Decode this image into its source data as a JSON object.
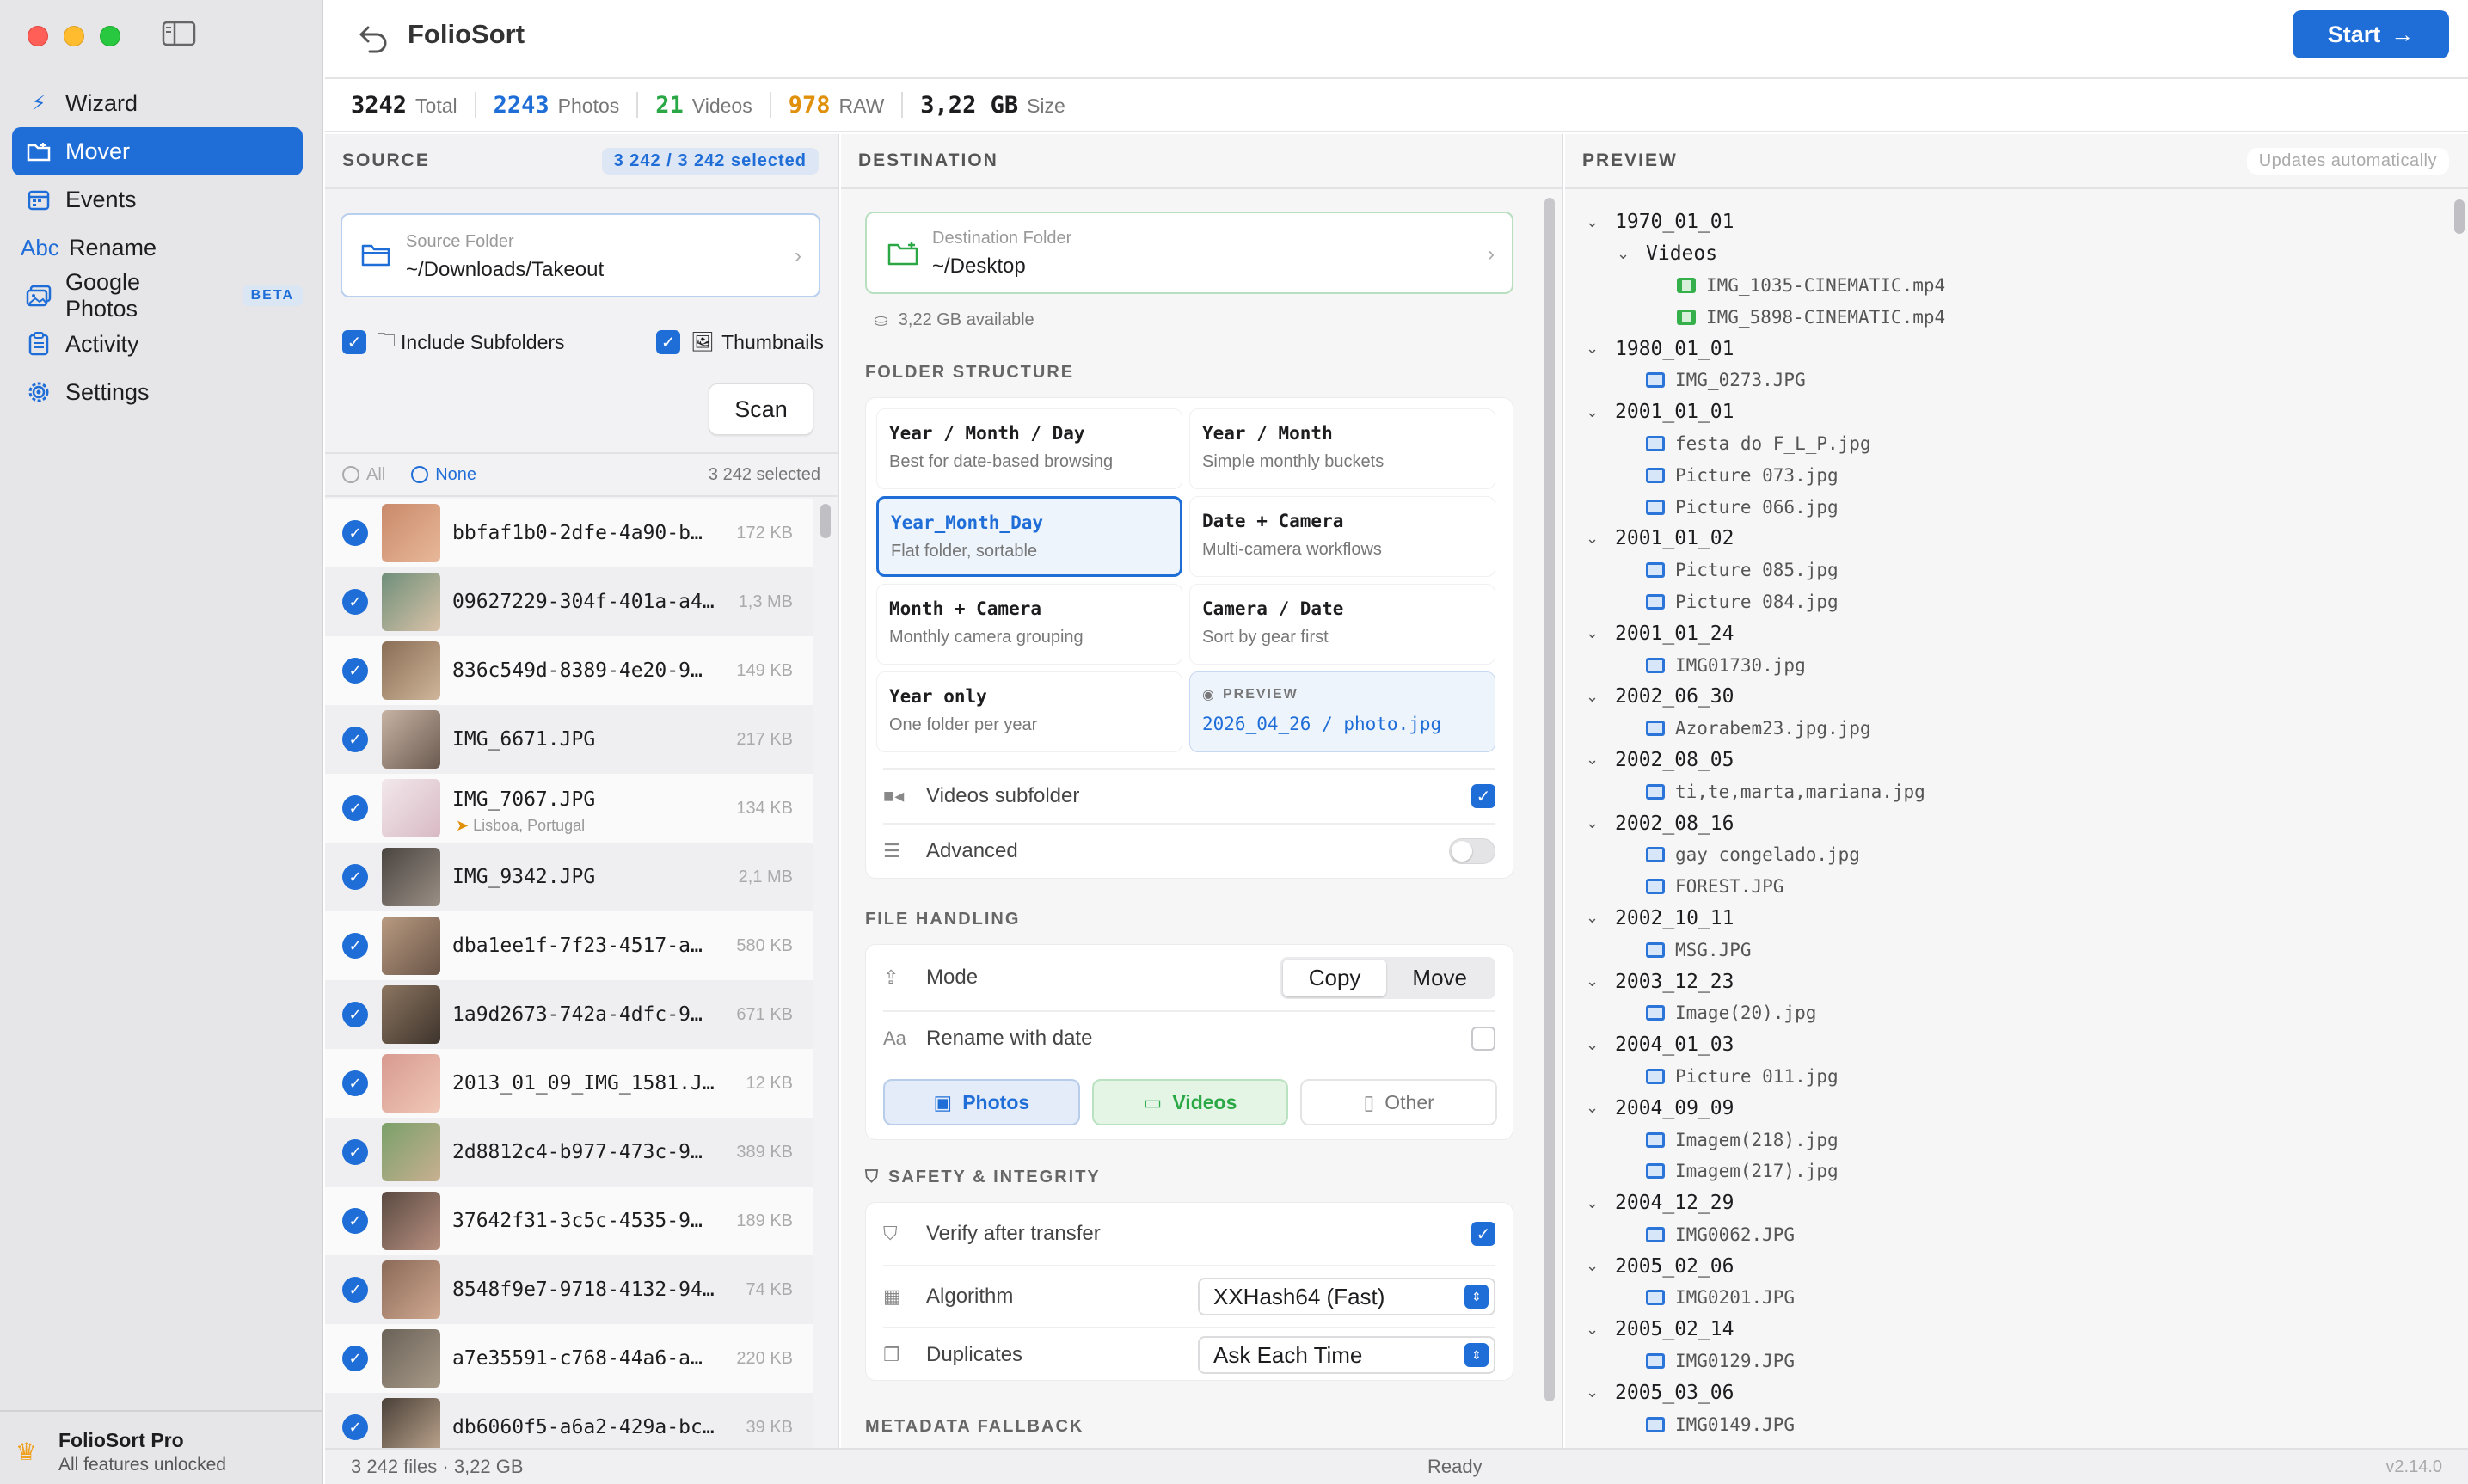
{
  "colors": {
    "accent": "#1f6ed8",
    "photos": "#1f6ed8",
    "videos": "#2aa845",
    "raw": "#e0900a",
    "total": "#1d1d1f"
  },
  "sidebar": {
    "items": [
      {
        "label": "Wizard",
        "icon": "wand-icon"
      },
      {
        "label": "Mover",
        "icon": "folder-move-icon",
        "active": true
      },
      {
        "label": "Events",
        "icon": "calendar-icon"
      },
      {
        "label": "Rename",
        "icon": "abc-icon",
        "icon_text": "Abc"
      },
      {
        "label": "Google Photos",
        "icon": "photos-icon",
        "badge": "BETA"
      },
      {
        "label": "Activity",
        "icon": "clipboard-icon"
      },
      {
        "label": "Settings",
        "icon": "gear-icon"
      }
    ],
    "pro_title": "FolioSort Pro",
    "pro_sub": "All features unlocked"
  },
  "header": {
    "title": "FolioSort",
    "start_label": "Start"
  },
  "stats": [
    {
      "num": "3242",
      "label": "Total"
    },
    {
      "num": "2243",
      "label": "Photos"
    },
    {
      "num": "21",
      "label": "Videos"
    },
    {
      "num": "978",
      "label": "RAW"
    },
    {
      "num": "3,22 GB",
      "label": "Size"
    }
  ],
  "source": {
    "title": "SOURCE",
    "selected_pill": "3 242 / 3 242 selected",
    "folder_label": "Source Folder",
    "folder_value": "~/Downloads/Takeout",
    "include_subfolders": "Include Subfolders",
    "thumbnails": "Thumbnails",
    "scan_label": "Scan",
    "all_label": "All",
    "none_label": "None",
    "count_label": "3 242 selected",
    "files": [
      {
        "name": "bbfaf1b0-2dfe-4a90-b…",
        "size": "172 KB",
        "c1": "#c98a6a",
        "c2": "#e8b89a"
      },
      {
        "name": "09627229-304f-401a-a4…",
        "size": "1,3 MB",
        "c1": "#6f8f7a",
        "c2": "#d9c2a8"
      },
      {
        "name": "836c549d-8389-4e20-9…",
        "size": "149 KB",
        "c1": "#8a6d55",
        "c2": "#cfb69a"
      },
      {
        "name": "IMG_6671.JPG",
        "size": "217 KB",
        "c1": "#c7b3a4",
        "c2": "#6b5a50"
      },
      {
        "name": "IMG_7067.JPG",
        "size": "134 KB",
        "loc": "Lisboa, Portugal",
        "c1": "#f2e8ec",
        "c2": "#d8b9c4"
      },
      {
        "name": "IMG_9342.JPG",
        "size": "2,1 MB",
        "c1": "#4a4440",
        "c2": "#9a8f86"
      },
      {
        "name": "dba1ee1f-7f23-4517-a…",
        "size": "580 KB",
        "c1": "#b89a80",
        "c2": "#6a5548"
      },
      {
        "name": "1a9d2673-742a-4dfc-9…",
        "size": "671 KB",
        "c1": "#8c7560",
        "c2": "#3e342c"
      },
      {
        "name": "2013_01_09_IMG_1581.J…",
        "size": "12 KB",
        "c1": "#d89a90",
        "c2": "#f0c8b8"
      },
      {
        "name": "2d8812c4-b977-473c-9…",
        "size": "389 KB",
        "c1": "#7aa06a",
        "c2": "#c8b090"
      },
      {
        "name": "37642f31-3c5c-4535-9…",
        "size": "189 KB",
        "c1": "#5a4a42",
        "c2": "#b89080"
      },
      {
        "name": "8548f9e7-9718-4132-94…",
        "size": "74 KB",
        "c1": "#8a6a58",
        "c2": "#d0a890"
      },
      {
        "name": "a7e35591-c768-44a6-a…",
        "size": "220 KB",
        "c1": "#6a6258",
        "c2": "#a89a88"
      },
      {
        "name": "db6060f5-a6a2-429a-bc…",
        "size": "39 KB",
        "c1": "#4a4038",
        "c2": "#c0a890"
      }
    ]
  },
  "destination": {
    "title": "DESTINATION",
    "folder_label": "Destination Folder",
    "folder_value": "~/Desktop",
    "available": "3,22 GB available",
    "folder_structure_title": "FOLDER STRUCTURE",
    "options": [
      {
        "t": "Year / Month / Day",
        "s": "Best for date-based browsing"
      },
      {
        "t": "Year / Month",
        "s": "Simple monthly buckets"
      },
      {
        "t": "Year_Month_Day",
        "s": "Flat folder, sortable",
        "selected": true
      },
      {
        "t": "Date + Camera",
        "s": "Multi-camera workflows"
      },
      {
        "t": "Month + Camera",
        "s": "Monthly camera grouping"
      },
      {
        "t": "Camera / Date",
        "s": "Sort by gear first"
      },
      {
        "t": "Year only",
        "s": "One folder per year"
      }
    ],
    "preview_label": "PREVIEW",
    "preview_value": "2026_04_26 / photo.jpg",
    "videos_subfolder": "Videos subfolder",
    "advanced": "Advanced",
    "file_handling_title": "FILE HANDLING",
    "mode_label": "Mode",
    "mode_copy": "Copy",
    "mode_move": "Move",
    "rename_label": "Rename with date",
    "rename_icon_text": "Aa",
    "type_photos": "Photos",
    "type_videos": "Videos",
    "type_other": "Other",
    "safety_title": "SAFETY & INTEGRITY",
    "verify_label": "Verify after transfer",
    "algorithm_label": "Algorithm",
    "algorithm_value": "XXHash64 (Fast)",
    "duplicates_label": "Duplicates",
    "duplicates_value": "Ask Each Time",
    "metadata_title": "METADATA FALLBACK"
  },
  "preview": {
    "title": "PREVIEW",
    "auto_pill": "Updates automatically",
    "tree": [
      {
        "depth": 0,
        "kind": "folder",
        "label": "1970_01_01"
      },
      {
        "depth": 1,
        "kind": "folder",
        "label": "Videos"
      },
      {
        "depth": 2,
        "kind": "video",
        "label": "IMG_1035-CINEMATIC.mp4"
      },
      {
        "depth": 2,
        "kind": "video",
        "label": "IMG_5898-CINEMATIC.mp4"
      },
      {
        "depth": 0,
        "kind": "folder",
        "label": "1980_01_01"
      },
      {
        "depth": 1,
        "kind": "image",
        "label": "IMG_0273.JPG"
      },
      {
        "depth": 0,
        "kind": "folder",
        "label": "2001_01_01"
      },
      {
        "depth": 1,
        "kind": "image",
        "label": "festa do F_L_P.jpg"
      },
      {
        "depth": 1,
        "kind": "image",
        "label": "Picture 073.jpg"
      },
      {
        "depth": 1,
        "kind": "image",
        "label": "Picture 066.jpg"
      },
      {
        "depth": 0,
        "kind": "folder",
        "label": "2001_01_02"
      },
      {
        "depth": 1,
        "kind": "image",
        "label": "Picture 085.jpg"
      },
      {
        "depth": 1,
        "kind": "image",
        "label": "Picture 084.jpg"
      },
      {
        "depth": 0,
        "kind": "folder",
        "label": "2001_01_24"
      },
      {
        "depth": 1,
        "kind": "image",
        "label": "IMG01730.jpg"
      },
      {
        "depth": 0,
        "kind": "folder",
        "label": "2002_06_30"
      },
      {
        "depth": 1,
        "kind": "image",
        "label": "Azorabem23.jpg.jpg"
      },
      {
        "depth": 0,
        "kind": "folder",
        "label": "2002_08_05"
      },
      {
        "depth": 1,
        "kind": "image",
        "label": "ti,te,marta,mariana.jpg"
      },
      {
        "depth": 0,
        "kind": "folder",
        "label": "2002_08_16"
      },
      {
        "depth": 1,
        "kind": "image",
        "label": "gay congelado.jpg"
      },
      {
        "depth": 1,
        "kind": "image",
        "label": "FOREST.JPG"
      },
      {
        "depth": 0,
        "kind": "folder",
        "label": "2002_10_11"
      },
      {
        "depth": 1,
        "kind": "image",
        "label": "MSG.JPG"
      },
      {
        "depth": 0,
        "kind": "folder",
        "label": "2003_12_23"
      },
      {
        "depth": 1,
        "kind": "image",
        "label": "Image(20).jpg"
      },
      {
        "depth": 0,
        "kind": "folder",
        "label": "2004_01_03"
      },
      {
        "depth": 1,
        "kind": "image",
        "label": "Picture 011.jpg"
      },
      {
        "depth": 0,
        "kind": "folder",
        "label": "2004_09_09"
      },
      {
        "depth": 1,
        "kind": "image",
        "label": "Imagem(218).jpg"
      },
      {
        "depth": 1,
        "kind": "image",
        "label": "Imagem(217).jpg"
      },
      {
        "depth": 0,
        "kind": "folder",
        "label": "2004_12_29"
      },
      {
        "depth": 1,
        "kind": "image",
        "label": "IMG0062.JPG"
      },
      {
        "depth": 0,
        "kind": "folder",
        "label": "2005_02_06"
      },
      {
        "depth": 1,
        "kind": "image",
        "label": "IMG0201.JPG"
      },
      {
        "depth": 0,
        "kind": "folder",
        "label": "2005_02_14"
      },
      {
        "depth": 1,
        "kind": "image",
        "label": "IMG0129.JPG"
      },
      {
        "depth": 0,
        "kind": "folder",
        "label": "2005_03_06"
      },
      {
        "depth": 1,
        "kind": "image",
        "label": "IMG0149.JPG"
      }
    ]
  },
  "footer": {
    "left": "3 242 files · 3,22 GB",
    "status": "Ready",
    "version": "v2.14.0"
  }
}
